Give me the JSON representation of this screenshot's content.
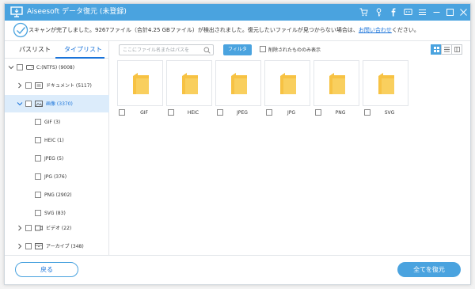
{
  "app": {
    "title": "Aiseesoft データ復元 (未登録)"
  },
  "infobar": {
    "message": "スキャンが完了しました。9267ファイル（合計4.25 GBファイル）が検出されました。復元したいファイルが見つからない場合は、",
    "link": "お問い合わせ",
    "suffix": "ください。"
  },
  "sidebar": {
    "tabs": [
      "パスリスト",
      "タイプリスト"
    ],
    "active_tab": "タイプリスト",
    "tree": [
      {
        "label": "C:(NTFS) (9008)",
        "icon": "drive-icon"
      },
      {
        "label": "ドキュメント (5117)",
        "icon": "document-icon"
      },
      {
        "label": "画像 (3370)",
        "icon": "image-icon",
        "selected": true
      },
      {
        "label": "GIF (3)"
      },
      {
        "label": "HEIC (1)"
      },
      {
        "label": "JPEG (5)"
      },
      {
        "label": "JPG (376)"
      },
      {
        "label": "PNG (2902)"
      },
      {
        "label": "SVG (83)"
      },
      {
        "label": "ビデオ (22)",
        "icon": "video-icon"
      },
      {
        "label": "アーカイブ (348)",
        "icon": "archive-icon"
      }
    ]
  },
  "toolbar": {
    "search_placeholder": "ここにファイル名またはパスを",
    "filter_label": "フィルタ",
    "deleted_only_label": "削除されたもののみ表示",
    "view_modes": [
      "grid-view",
      "list-view",
      "detail-view"
    ],
    "active_view": "grid-view"
  },
  "folders": [
    {
      "name": "GIF"
    },
    {
      "name": "HEIC"
    },
    {
      "name": "JPEG"
    },
    {
      "name": "JPG"
    },
    {
      "name": "PNG"
    },
    {
      "name": "SVG"
    }
  ],
  "footer": {
    "back_label": "戻る",
    "recover_label": "全てを復元"
  },
  "colors": {
    "accent": "#4aa3df",
    "link": "#1a73d9",
    "folder": "#f7c243",
    "selected_row": "#dcecfb"
  }
}
